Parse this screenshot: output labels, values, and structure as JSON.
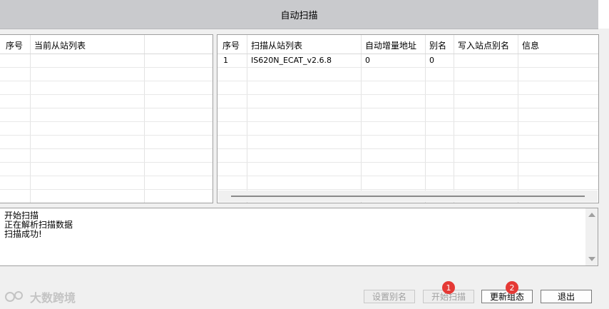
{
  "title": "自动扫描",
  "left_table": {
    "headers": [
      "序号",
      "当前从站列表"
    ],
    "rows": []
  },
  "right_table": {
    "headers": [
      "序号",
      "扫描从站列表",
      "自动增量地址",
      "别名",
      "写入站点别名",
      "信息"
    ],
    "rows": [
      [
        "1",
        "IS620N_ECAT_v2.6.8",
        "0",
        "0",
        "",
        ""
      ]
    ]
  },
  "log": {
    "lines": [
      "开始扫描",
      "正在解析扫描数据",
      "扫描成功!"
    ]
  },
  "buttons": {
    "set_alias": "设置别名",
    "start_scan": "开始扫描",
    "update_config": "更新组态",
    "exit": "退出"
  },
  "badges": {
    "badge1": "1",
    "badge2": "2"
  },
  "watermark": "大数跨境",
  "colors": {
    "badge": "#e53935",
    "titlebar": "#c9cacd"
  }
}
